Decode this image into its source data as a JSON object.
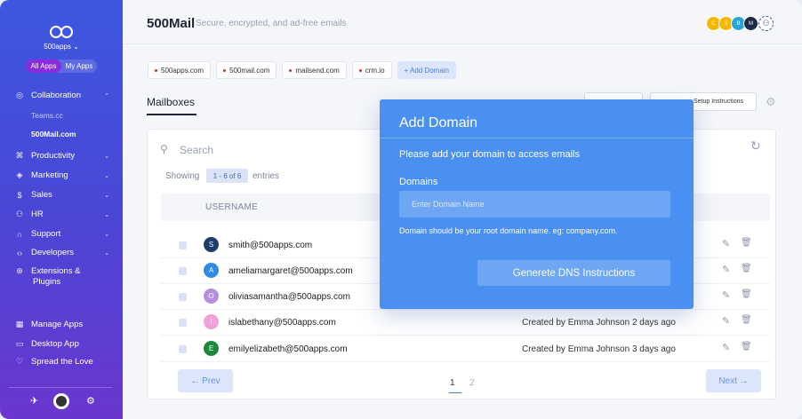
{
  "sidebar": {
    "org": "500apps ⌄",
    "switch": {
      "all_apps": "All Apps",
      "my_apps": "My Apps"
    },
    "collaboration": "Collaboration",
    "sub_items": [
      "Teams.cc",
      "500Mail.com"
    ],
    "items": [
      "Productivity",
      "Marketing",
      "Sales",
      "HR",
      "Support",
      "Developers"
    ],
    "extensions": "Extensions &",
    "extensions2": "Plugins",
    "manage_apps": "Manage Apps",
    "desktop_app": "Desktop App",
    "spread_love": "Spread the Love"
  },
  "header": {
    "title": "500Mail",
    "subtitle": "Secure, encrypted, and ad-free emails",
    "avatars": [
      "C",
      "S",
      "B",
      "M"
    ]
  },
  "domains": [
    "500apps.com",
    "500mail.com",
    "mailsend.com",
    "crm.io"
  ],
  "add_domain": "+ Add Domain",
  "mailboxes_tab": "Mailboxes",
  "setup_btn": "Setup Instructions",
  "search_placeholder": "Search",
  "showing": "Showing",
  "range": "1 - 6 of 6",
  "entries": "entries",
  "username_header": "USERNAME",
  "rows": [
    {
      "initial": "S",
      "email": "smith@500apps.com",
      "created": "",
      "color": "#1f3d6b"
    },
    {
      "initial": "A",
      "email": "ameliamargaret@500apps.com",
      "created": "",
      "color": "#2e8ae6"
    },
    {
      "initial": "O",
      "email": "oliviasamantha@500apps.com",
      "created": "",
      "color": "#b58ee0"
    },
    {
      "initial": "I",
      "email": "islabethany@500apps.com",
      "created": "Created by Emma Johnson 2 days ago",
      "color": "#f2a0d8"
    },
    {
      "initial": "E",
      "email": "emilyelizabeth@500apps.com",
      "created": "Created by Emma Johnson 3 days ago",
      "color": "#1a8a3a"
    }
  ],
  "pagination": {
    "prev": "← Prev",
    "next": "Next →",
    "pages": [
      "1",
      "2"
    ]
  },
  "modal": {
    "title": "Add Domain",
    "description": "Please add your domain to access emails",
    "label": "Domains",
    "placeholder": "Enter Domain Name",
    "hint": "Domain should be your root domain name. eg: company.com.",
    "button": "Generete DNS Instructions"
  }
}
